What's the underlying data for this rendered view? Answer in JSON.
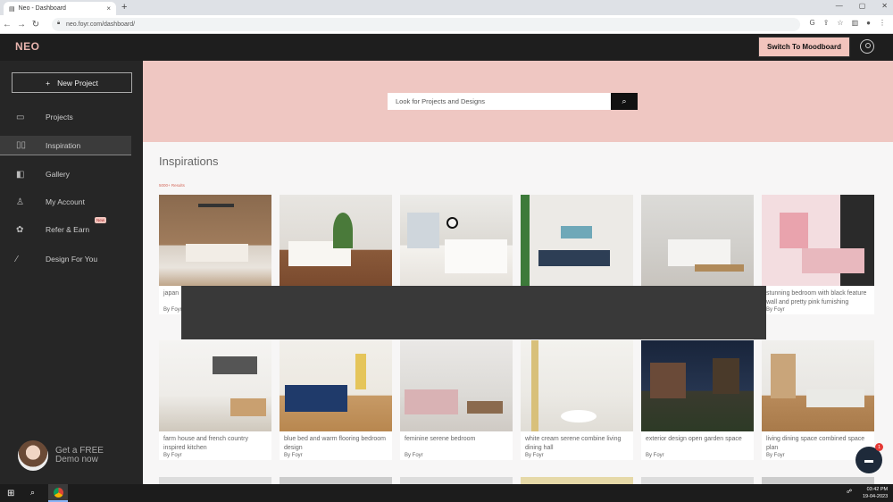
{
  "browser": {
    "tab_title": "Neo - Dashboard",
    "tab_close": "×",
    "new_tab": "+",
    "url": "neo.foyr.com/dashboard/"
  },
  "header": {
    "logo": "NEO",
    "switch_button": "Switch To Moodboard"
  },
  "sidebar": {
    "new_project": "New Project",
    "items": [
      {
        "label": "Projects",
        "icon": "folder-icon",
        "glyph": "▭"
      },
      {
        "label": "Inspiration",
        "icon": "book-icon",
        "glyph": "▯▯",
        "active": true
      },
      {
        "label": "Gallery",
        "icon": "gallery-icon",
        "glyph": "◧"
      },
      {
        "label": "My Account",
        "icon": "user-icon",
        "glyph": "♙"
      },
      {
        "label": "Refer & Earn",
        "icon": "gift-icon",
        "glyph": "✿",
        "badge": "New"
      },
      {
        "label": "Design For You",
        "icon": "magic-wand-icon",
        "glyph": "⁄"
      }
    ],
    "free_demo": "Get a FREE Demo now"
  },
  "search": {
    "placeholder": "Look for Projects and Designs"
  },
  "inspirations": {
    "title": "Inspirations",
    "results": "5000+ Results",
    "row1": [
      {
        "caption": "japan",
        "by": "By Foyr"
      },
      {
        "caption": "",
        "by": ""
      },
      {
        "caption": "",
        "by": ""
      },
      {
        "caption": "",
        "by": ""
      },
      {
        "caption": "",
        "by": ""
      },
      {
        "caption": "stunning bedroom with black feature wall and pretty pink furnishing",
        "by": "By Foyr"
      }
    ],
    "row2": [
      {
        "caption": "farm house and french country inspired kitchen",
        "by": "By Foyr"
      },
      {
        "caption": "blue bed and warm flooring bedroom design",
        "by": "By Foyr"
      },
      {
        "caption": "feminine serene bedroom",
        "by": "By Foyr"
      },
      {
        "caption": "white cream serene combine living dining hall",
        "by": "By Foyr"
      },
      {
        "caption": "exterior design open garden space",
        "by": "By Foyr"
      },
      {
        "caption": "living dining space combined space plan",
        "by": "By Foyr"
      }
    ]
  },
  "chat": {
    "badge": "1"
  },
  "taskbar": {
    "time": "03:42 PM",
    "date": "19-04-2023"
  }
}
